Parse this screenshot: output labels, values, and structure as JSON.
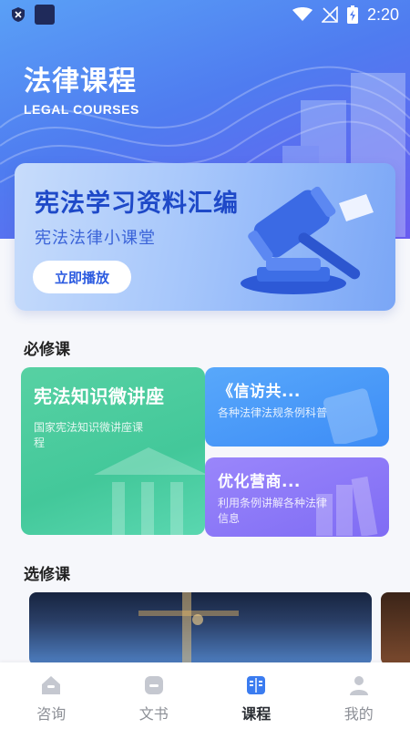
{
  "status_bar": {
    "time": "2:20"
  },
  "header": {
    "title": "法律课程",
    "subtitle": "LEGAL COURSES"
  },
  "banner": {
    "title": "宪法学习资料汇编",
    "subtitle": "宪法法律小课堂",
    "button": "立即播放"
  },
  "required": {
    "title": "必修课",
    "cards": [
      {
        "title": "宪法知识微讲座",
        "desc": "国家宪法知识微讲座课程"
      },
      {
        "title": "《信访共...",
        "desc": "各种法律法规条例科普"
      },
      {
        "title": "优化营商...",
        "desc": "利用条例讲解各种法律信息"
      }
    ]
  },
  "elective": {
    "title": "选修课"
  },
  "tabs": [
    {
      "label": "咨询",
      "icon": "home-icon"
    },
    {
      "label": "文书",
      "icon": "document-icon"
    },
    {
      "label": "课程",
      "icon": "book-icon",
      "active": true
    },
    {
      "label": "我的",
      "icon": "user-icon"
    }
  ],
  "colors": {
    "accent": "#2c5be0",
    "green": "#43c89a",
    "blue": "#3d8cf6",
    "purple": "#7f6cf4"
  }
}
